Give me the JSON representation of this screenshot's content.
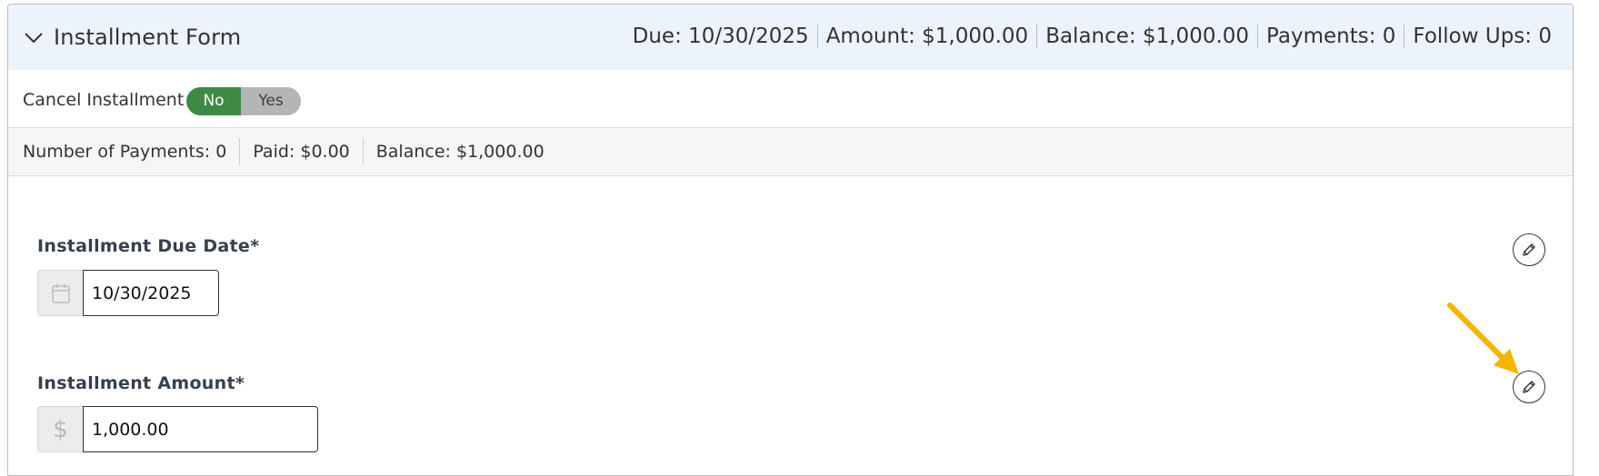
{
  "header": {
    "title": "Installment Form",
    "summary": {
      "due": "Due: 10/30/2025",
      "amount": "Amount: $1,000.00",
      "balance": "Balance: $1,000.00",
      "payments": "Payments: 0",
      "follow_ups": "Follow Ups: 0"
    }
  },
  "cancel": {
    "label": "Cancel Installment",
    "options": {
      "no": "No",
      "yes": "Yes"
    },
    "selected": "No"
  },
  "stats": {
    "num_payments": "Number of Payments: 0",
    "paid": "Paid: $0.00",
    "balance": "Balance: $1,000.00"
  },
  "fields": {
    "due_date": {
      "label": "Installment Due Date*",
      "value": "10/30/2025",
      "icon": "calendar-icon"
    },
    "amount": {
      "label": "Installment Amount*",
      "value": "1,000.00",
      "prefix": "$"
    }
  },
  "colors": {
    "header_bg": "#edf3fc",
    "toggle_on": "#3e8a45",
    "toggle_off": "#b5b5b5",
    "annotation_arrow": "#f5b400"
  }
}
